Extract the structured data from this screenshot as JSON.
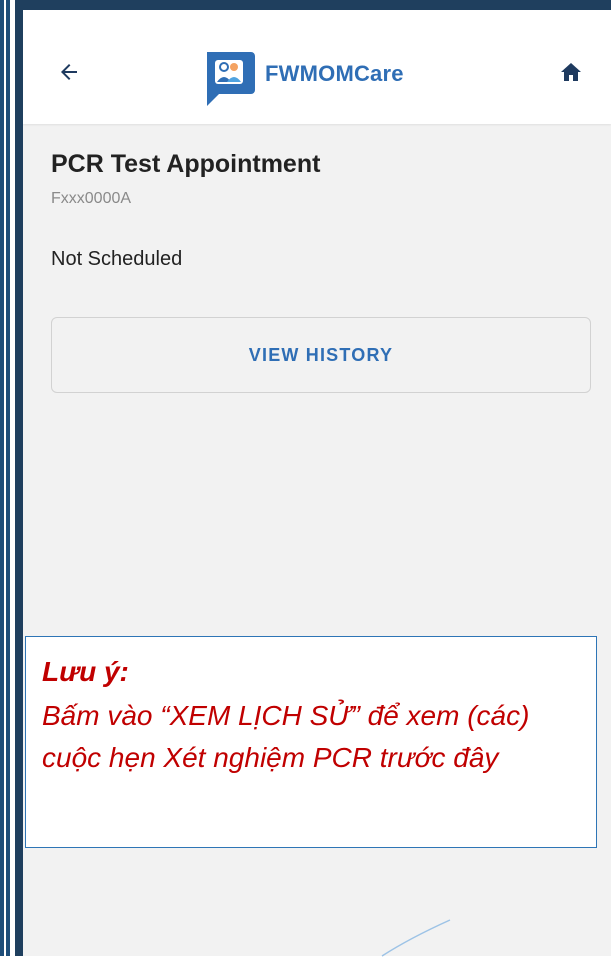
{
  "app": {
    "name": "FWMOMCare",
    "back_icon": "arrow-left-icon",
    "home_icon": "home-icon",
    "logo_icon": "fwmomcare-logo-icon"
  },
  "page": {
    "title": "PCR Test Appointment",
    "reference_id": "Fxxx0000A",
    "status": "Not Scheduled",
    "view_history_label": "VIEW HISTORY"
  },
  "note": {
    "heading": "Lưu ý:",
    "body": "Bấm vào “XEM LỊCH SỬ” để xem (các) cuộc hẹn Xét nghiệm PCR trước đây"
  },
  "colors": {
    "brand_blue": "#2f6eb5",
    "frame": "#1f3f5e",
    "note_text": "#c00000",
    "note_border": "#2e75b6"
  }
}
